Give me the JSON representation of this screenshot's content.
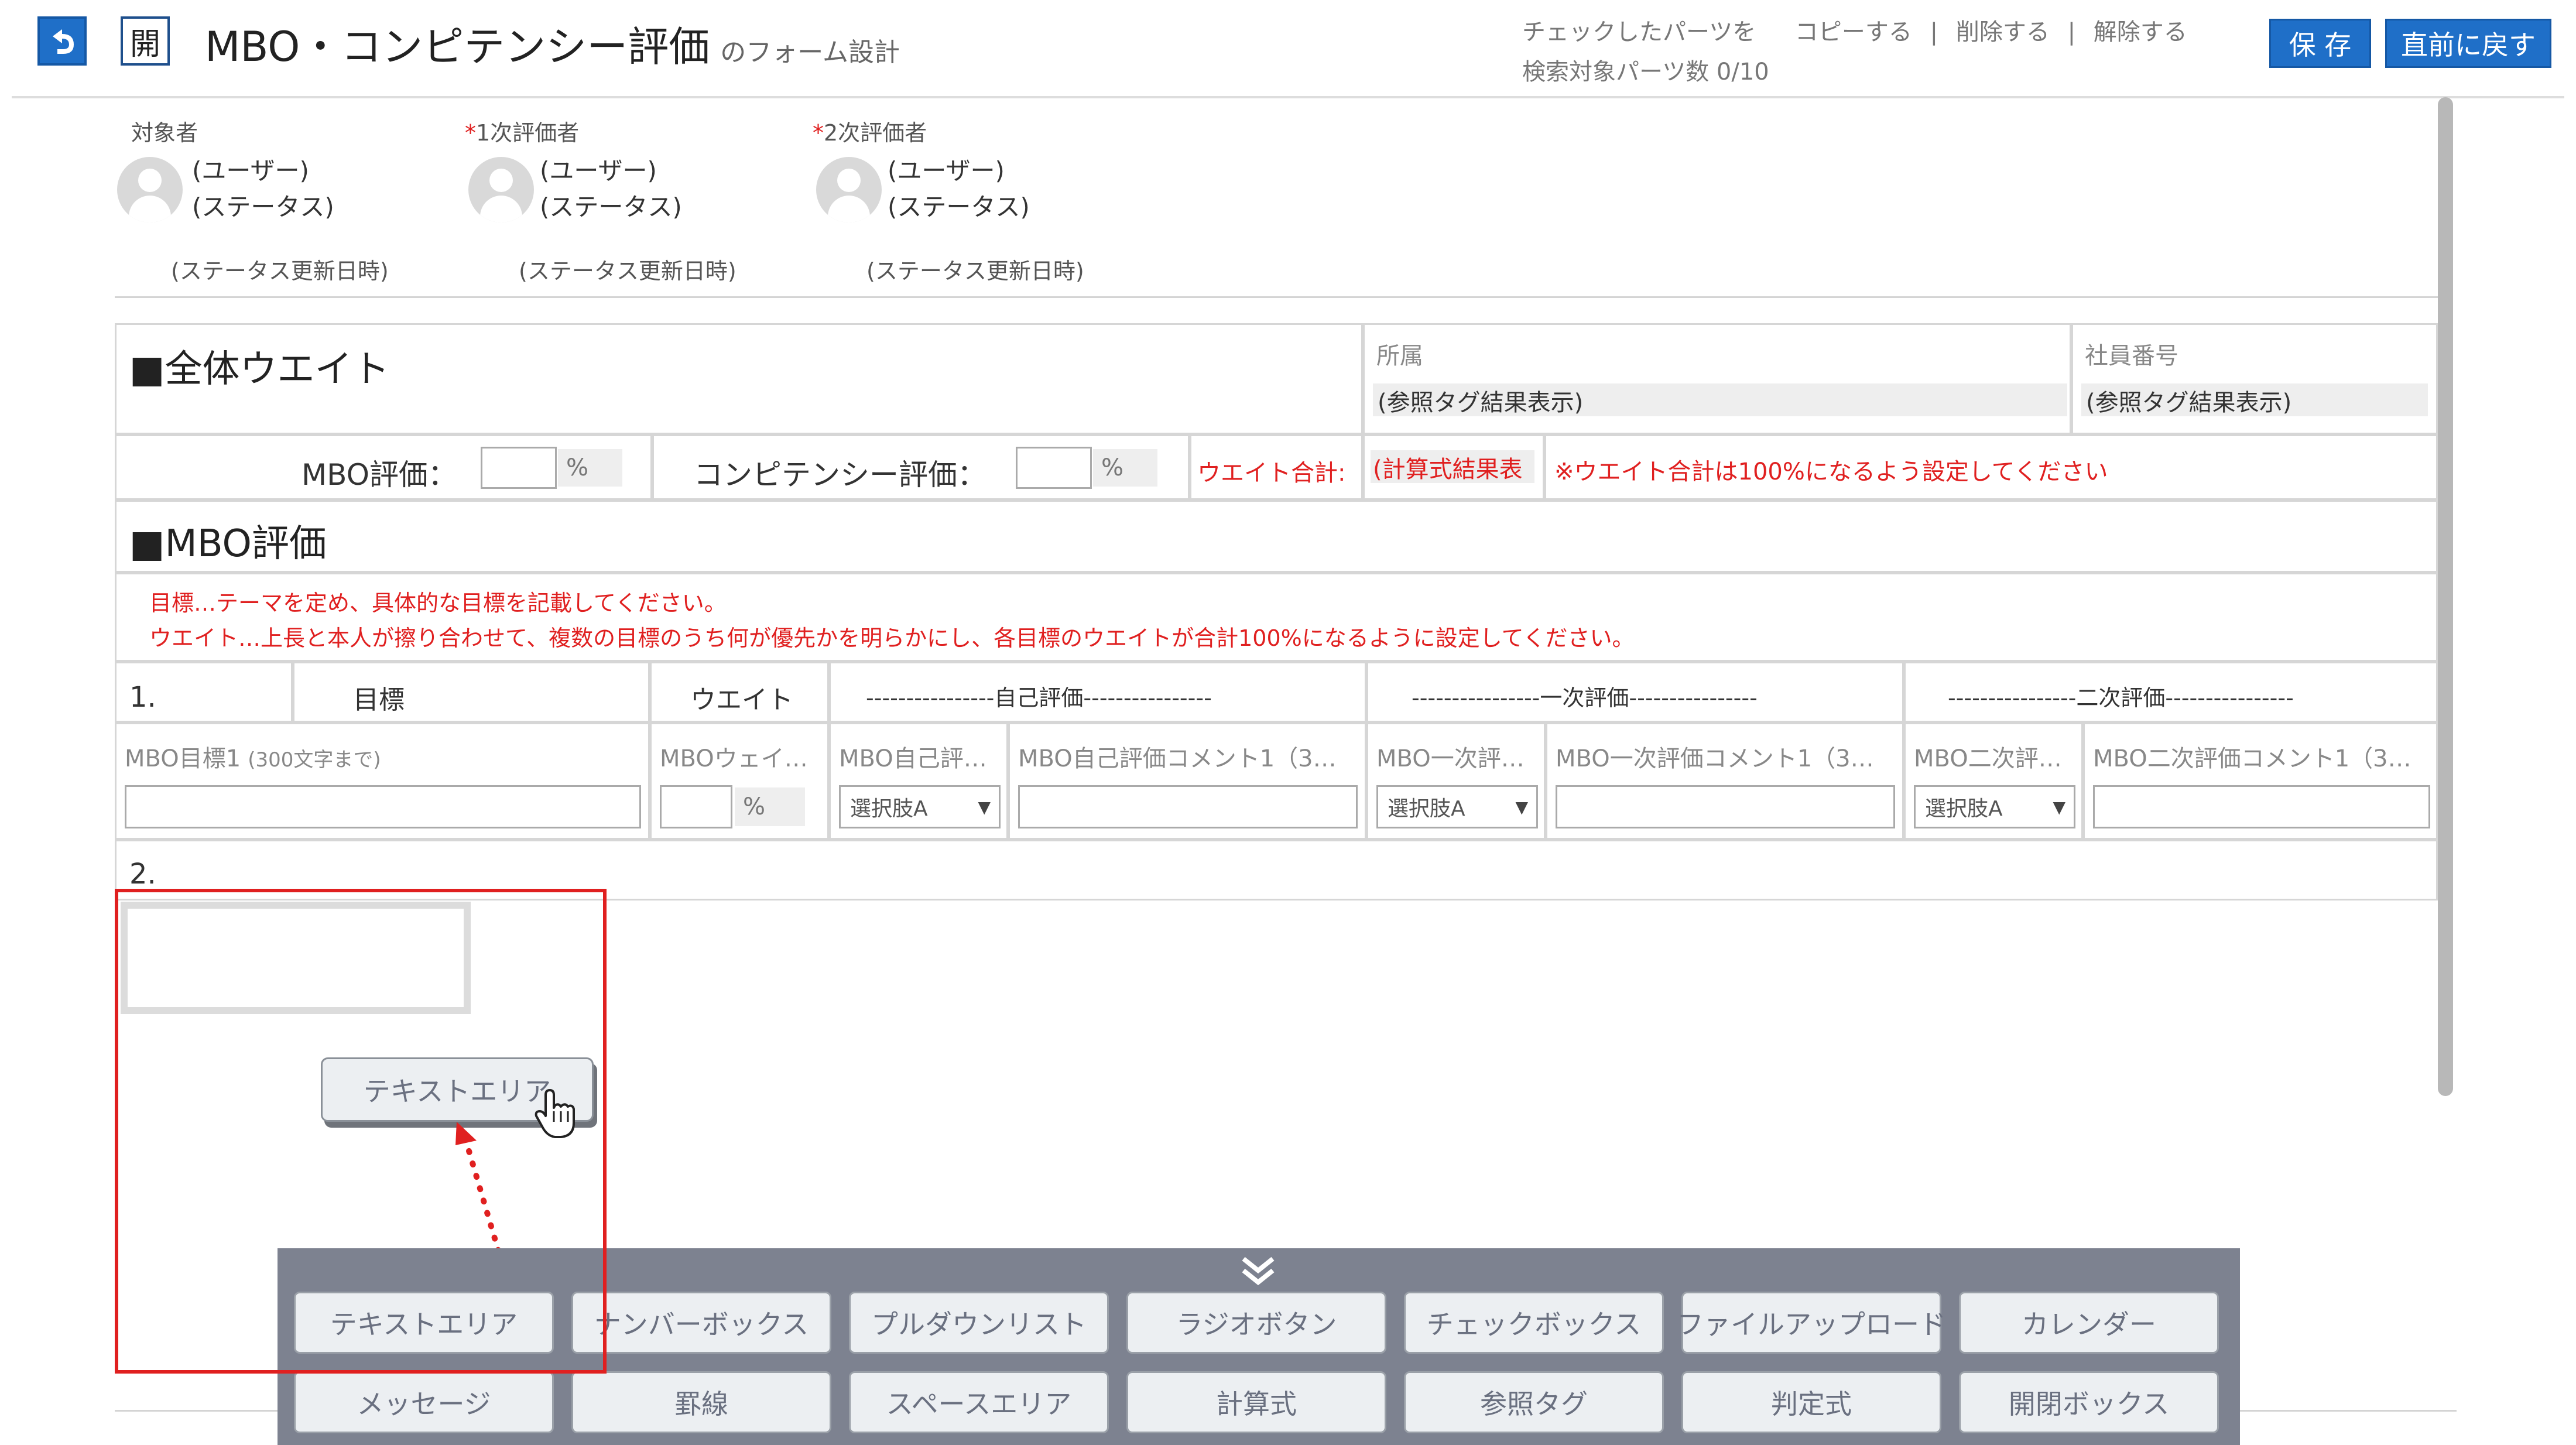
{
  "header": {
    "back_icon": "undo-arrow-icon",
    "open_label": "開",
    "title": "MBO・コンピテンシー評価",
    "subtitle": "のフォーム設計",
    "checked_parts": "チェックしたパーツを",
    "copy": "コピーする",
    "delete": "削除する",
    "release": "解除する",
    "search_count": "検索対象パーツ数 0/10",
    "save": "保 存",
    "revert": "直前に戻す",
    "sep": "|"
  },
  "evaluators": [
    {
      "role": "対象者",
      "required": false,
      "user": "(ユーザー)",
      "status": "(ステータス)",
      "date": "(ステータス更新日時)"
    },
    {
      "role": "1次評価者",
      "required": true,
      "user": "(ユーザー)",
      "status": "(ステータス)",
      "date": "(ステータス更新日時)"
    },
    {
      "role": "2次評価者",
      "required": true,
      "user": "(ユーザー)",
      "status": "(ステータス)",
      "date": "(ステータス更新日時)"
    }
  ],
  "required_mark": "*",
  "weight_section": {
    "title": "■全体ウエイト",
    "affiliation_label": "所属",
    "affiliation_value": "(参照タグ結果表示)",
    "employee_no_label": "社員番号",
    "employee_no_value": "(参照タグ結果表示)",
    "mbo_label": "MBO評価：",
    "competency_label": "コンピテンシー評価：",
    "pct": "%",
    "total_label": "ウエイト合計:",
    "total_value": "(計算式結果表",
    "note": "※ウエイト合計は100%になるよう設定してください"
  },
  "mbo_section": {
    "title": "■MBO評価",
    "instruction1": "目標…テーマを定め、具体的な目標を記載してください。",
    "instruction2": "ウエイト…上長と本人が擦り合わせて、複数の目標のうち何が優先かを明らかにし、各目標のウエイトが合計100%になるように設定してください。",
    "row1_num": "1.",
    "col_goal": "目標",
    "col_weight": "ウエイト",
    "col_self": "----------------自己評価----------------",
    "col_first": "----------------一次評価----------------",
    "col_second": "----------------二次評価----------------",
    "goal_field": "MBO目標1",
    "goal_hint": "(300文字まで)",
    "weight_field": "MBOウェイ…",
    "self_field": "MBO自己評…",
    "self_comment": "MBO自己評価コメント1（3…",
    "first_field": "MBO一次評…",
    "first_comment": "MBO一次評価コメント1（3…",
    "second_field": "MBO二次評…",
    "second_comment": "MBO二次評価コメント1（3…",
    "option": "選択肢A",
    "row2_num": "2."
  },
  "drag_item": "テキストエリア",
  "palette": {
    "collapse_icon": "double-chevron-down-icon",
    "row1": [
      "テキストエリア",
      "ナンバーボックス",
      "プルダウンリスト",
      "ラジオボタン",
      "チェックボックス",
      "ファイルアップロード",
      "カレンダー"
    ],
    "row2": [
      "メッセージ",
      "罫線",
      "スペースエリア",
      "計算式",
      "参照タグ",
      "判定式",
      "開閉ボックス"
    ]
  },
  "colors": {
    "accent": "#1f6fc8",
    "red": "#e02020",
    "palette_bg": "#7d8290"
  }
}
